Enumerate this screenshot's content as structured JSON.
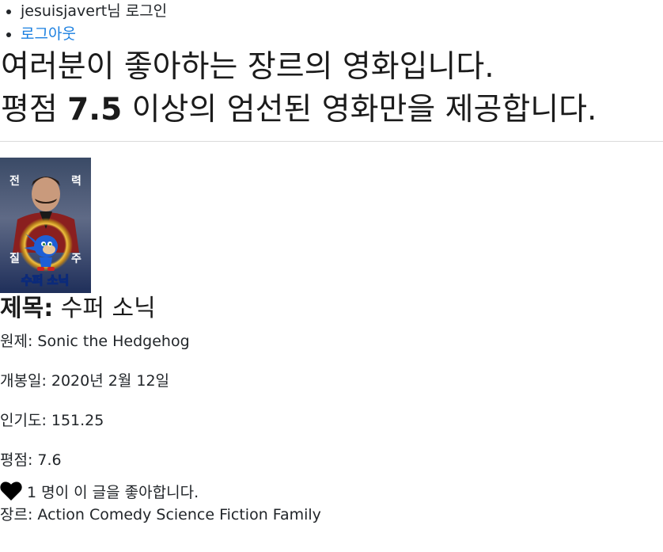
{
  "nav": {
    "user_greeting": "jesuisjavert님 로그인",
    "logout_label": "로그아웃"
  },
  "header": {
    "line1": "여러분이 좋아하는 장르의 영화입니다.",
    "line2_prefix": "평점 ",
    "line2_rating": "7.5",
    "line2_suffix": " 이상의 엄선된 영화만을 제공합니다."
  },
  "movie": {
    "poster_text": {
      "top_left": "전",
      "top_right": "력",
      "mid_left": "질",
      "mid_right": "주",
      "logo": "수퍼 소닉"
    },
    "title_label": "제목:",
    "title_value": " 수퍼 소닉",
    "original_title": "원제: Sonic the Hedgehog",
    "release_date": "개봉일: 2020년 2월 12일",
    "popularity": "인기도: 151.25",
    "rating": "평점: 7.6",
    "likes_text": " 1 명이 이 글을 좋아합니다.",
    "genres": "장르: Action Comedy Science Fiction Family"
  },
  "colors": {
    "link": "#1a7fe0",
    "heart": "#000000"
  },
  "icons": {
    "like": "heart-icon"
  }
}
